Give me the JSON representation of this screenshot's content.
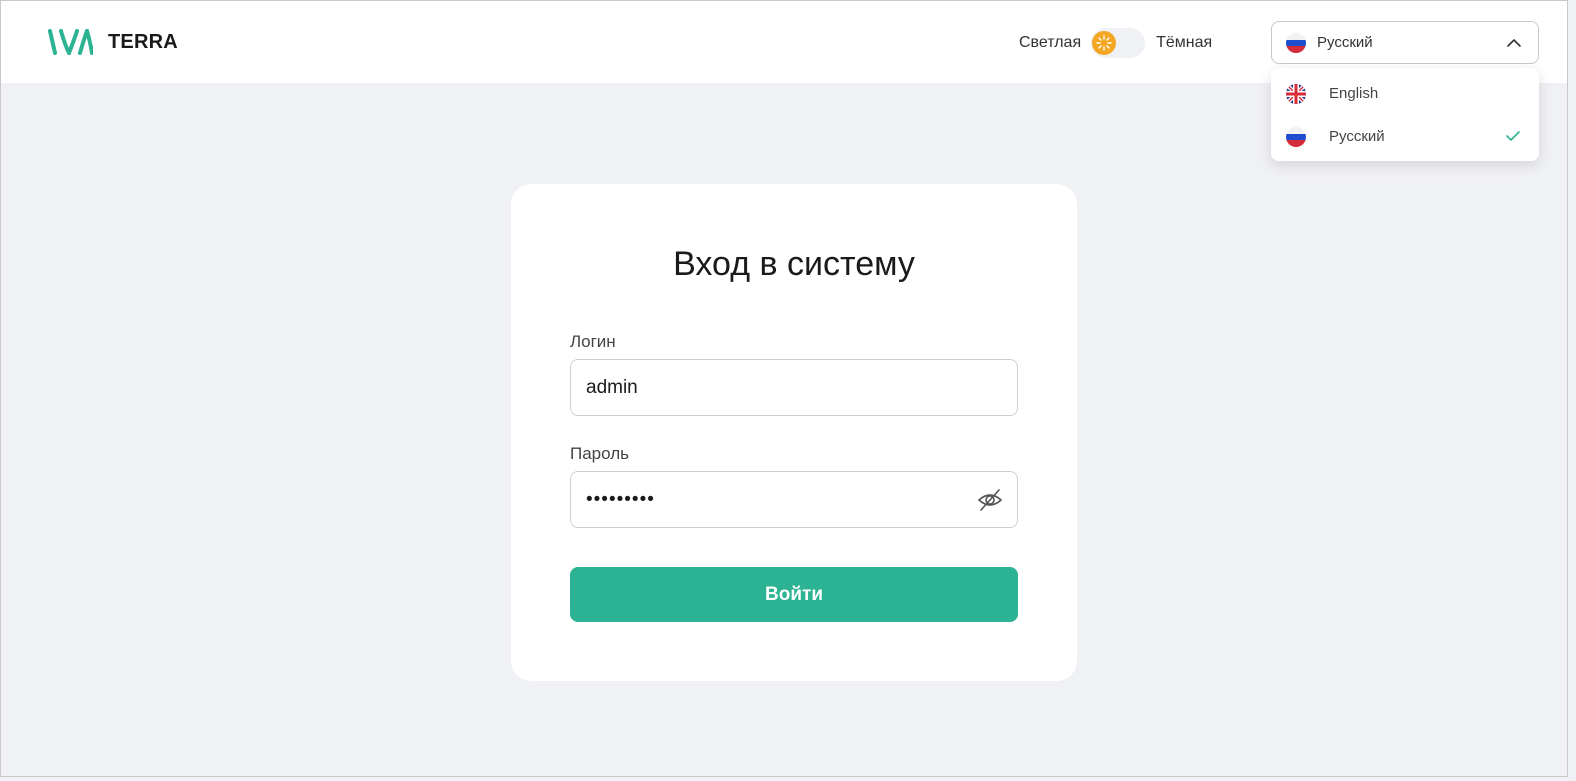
{
  "brand": {
    "name": "TERRA",
    "logo_icon": "iva-logo-icon",
    "accent_color": "#2bb393"
  },
  "theme_switch": {
    "light_label": "Светлая",
    "dark_label": "Тёмная",
    "current": "light",
    "knob_icon": "sun-icon",
    "knob_color": "#f5a623"
  },
  "language": {
    "selected_label": "Русский",
    "options": [
      {
        "label": "English",
        "flag": "uk-flag-icon",
        "selected": false
      },
      {
        "label": "Русский",
        "flag": "ru-flag-icon",
        "selected": true
      }
    ]
  },
  "login_form": {
    "title": "Вход в систему",
    "login_label": "Логин",
    "login_value": "admin",
    "password_label": "Пароль",
    "password_value": "•••••••••",
    "submit_label": "Войти"
  }
}
